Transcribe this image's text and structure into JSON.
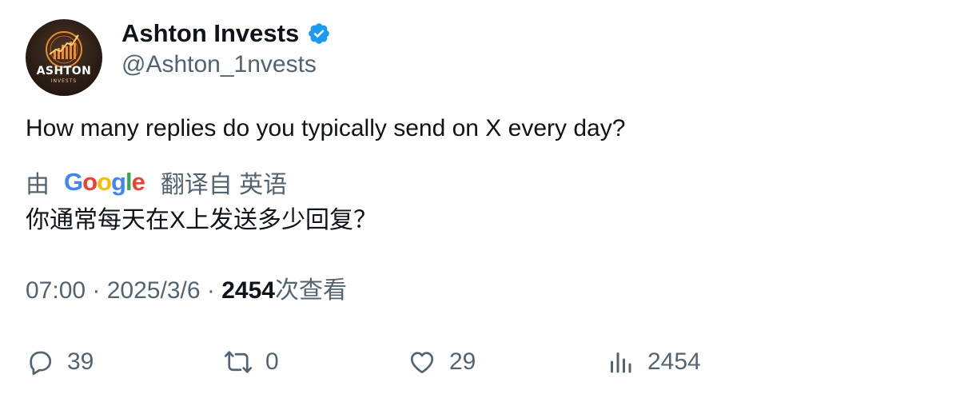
{
  "author": {
    "display_name": "Ashton Invests",
    "handle": "@Ashton_1nvests",
    "verified": true,
    "verified_icon": "verified-badge-icon",
    "verified_color": "#1d9bf0",
    "avatar_text": "ASHTON",
    "avatar_subtext": "INVESTS"
  },
  "tweet": {
    "text": "How many replies do you typically send on X every day?"
  },
  "translation": {
    "prefix": "由",
    "provider": "Google",
    "suffix": "翻译自 英语",
    "text": "你通常每天在X上发送多少回复？"
  },
  "meta": {
    "time": "07:00",
    "separator": "·",
    "date": "2025/3/6",
    "views_count": "2454",
    "views_label": "次查看"
  },
  "actions": {
    "replies": {
      "icon": "reply-icon",
      "count": "39"
    },
    "reposts": {
      "icon": "repost-icon",
      "count": "0"
    },
    "likes": {
      "icon": "heart-icon",
      "count": "29"
    },
    "views": {
      "icon": "views-chart-icon",
      "count": "2454"
    }
  },
  "colors": {
    "text_primary": "#0f1419",
    "text_secondary": "#536471",
    "google_blue": "#4285f4",
    "google_red": "#ea4335",
    "google_yellow": "#fbbc05",
    "google_green": "#34a853"
  }
}
